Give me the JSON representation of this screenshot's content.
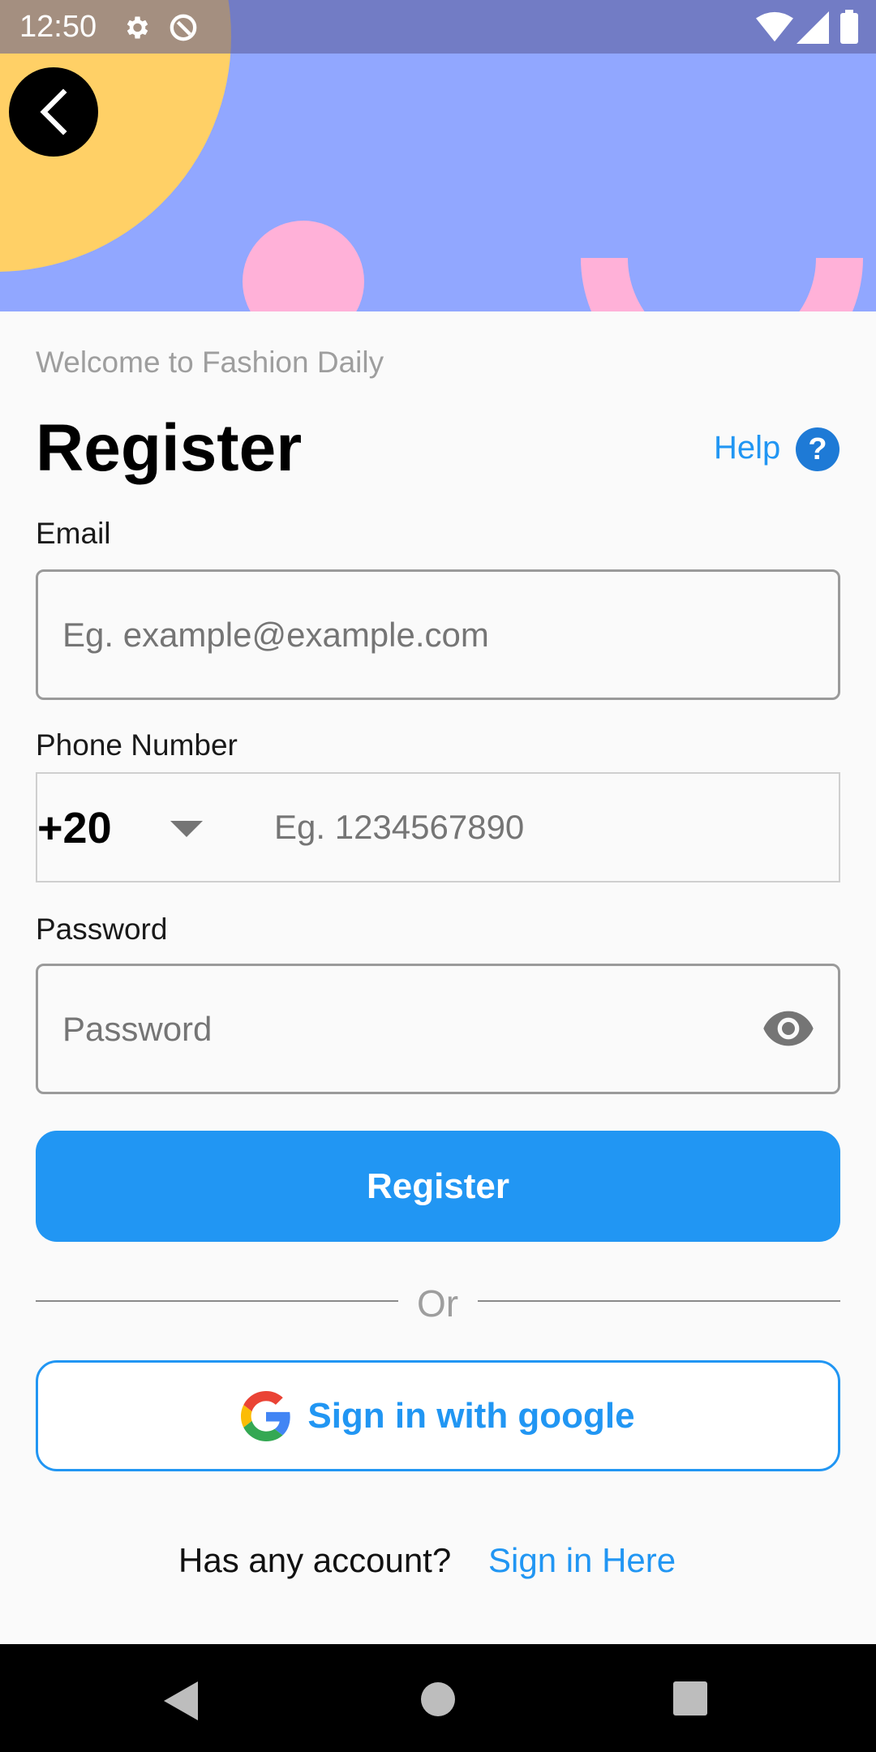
{
  "status_bar": {
    "time": "12:50",
    "icons": [
      "settings-icon",
      "sync-icon",
      "wifi-icon",
      "signal-icon",
      "battery-icon"
    ]
  },
  "header": {
    "back_icon": "chevron-left-icon",
    "colors": {
      "background": "#91a7ff",
      "sun": "#ffd066",
      "shapes": "#ffb1d8"
    }
  },
  "main": {
    "welcome": "Welcome to Fashion Daily",
    "title": "Register",
    "help": {
      "label": "Help",
      "icon": "?"
    },
    "email": {
      "label": "Email",
      "placeholder": "Eg. example@example.com"
    },
    "phone": {
      "label": "Phone Number",
      "country_code": "+20",
      "placeholder": "Eg. 1234567890"
    },
    "password": {
      "label": "Password",
      "placeholder": "Password",
      "toggle_icon": "eye-icon"
    },
    "register_button": "Register",
    "divider": "Or",
    "google_button": "Sign in with google",
    "footer": {
      "question": "Has any account?",
      "link": "Sign in Here"
    }
  },
  "accent_color": "#2196f3",
  "nav_bar": {
    "icons": [
      "back-triangle-icon",
      "home-circle-icon",
      "recents-square-icon"
    ]
  }
}
